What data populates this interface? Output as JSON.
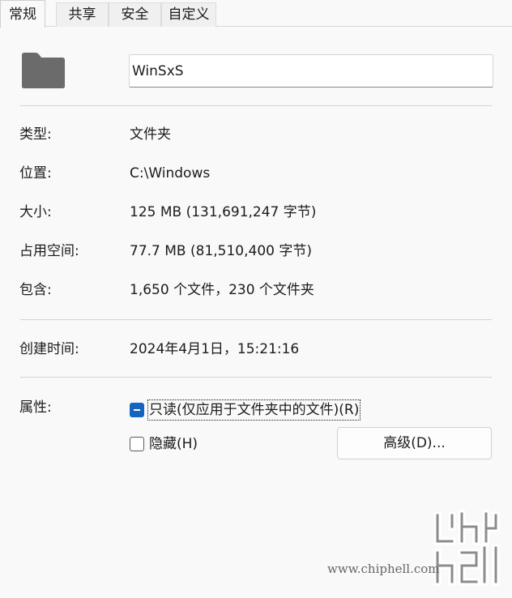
{
  "tabs": [
    "常规",
    "共享",
    "安全",
    "自定义"
  ],
  "folder": {
    "icon": "folder-icon",
    "name": "WinSxS"
  },
  "properties": {
    "type_label": "类型:",
    "type_value": "文件夹",
    "location_label": "位置:",
    "location_value": "C:\\Windows",
    "size_label": "大小:",
    "size_value": "125 MB (131,691,247 字节)",
    "disk_label": "占用空间:",
    "disk_value": "77.7 MB (81,510,400 字节)",
    "contains_label": "包含:",
    "contains_value": "1,650 个文件，230 个文件夹",
    "created_label": "创建时间:",
    "created_value": "2024年4月1日，15:21:16"
  },
  "attributes": {
    "label": "属性:",
    "readonly_label": "只读(仅应用于文件夹中的文件)(R)",
    "readonly_state": "indeterminate",
    "hidden_label": "隐藏(H)",
    "hidden_state": "unchecked",
    "advanced_label": "高级(D)..."
  },
  "watermark": {
    "logo_text": "chip hell",
    "url": "www.chiphell.com"
  },
  "colors": {
    "accent": "#1565c0",
    "folder": "#6b6b6b",
    "background": "#f9f9f9"
  }
}
